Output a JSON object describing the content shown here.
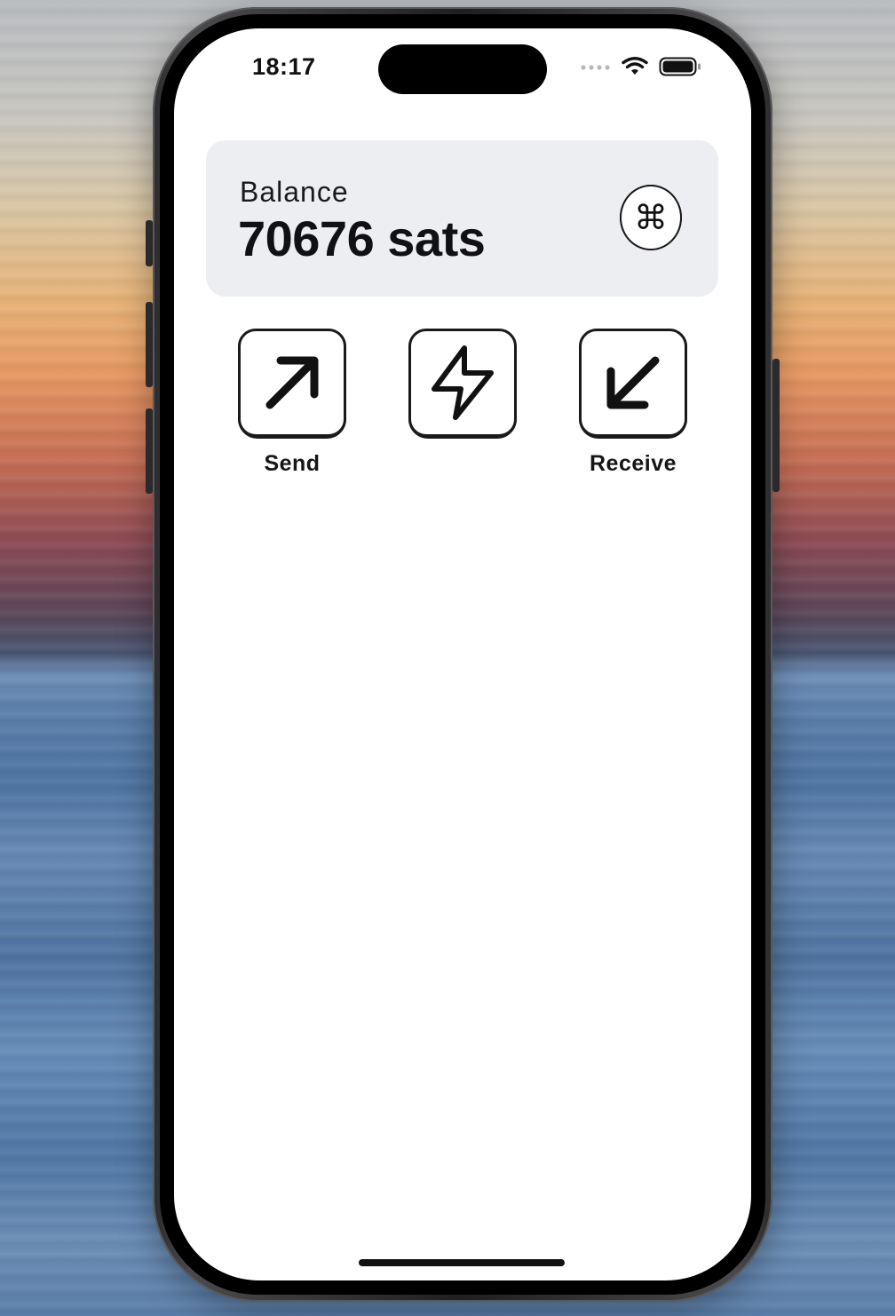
{
  "status_bar": {
    "time": "18:17"
  },
  "balance_card": {
    "label": "Balance",
    "value": "70676 sats",
    "command_icon": "command-icon"
  },
  "actions": [
    {
      "label": "Send",
      "icon": "arrow-up-right-icon"
    },
    {
      "label": "",
      "icon": "lightning-icon"
    },
    {
      "label": "Receive",
      "icon": "arrow-down-left-icon"
    }
  ],
  "colors": {
    "screen_background": "#ffffff",
    "card_background": "#eceef2",
    "ink": "#111113"
  }
}
